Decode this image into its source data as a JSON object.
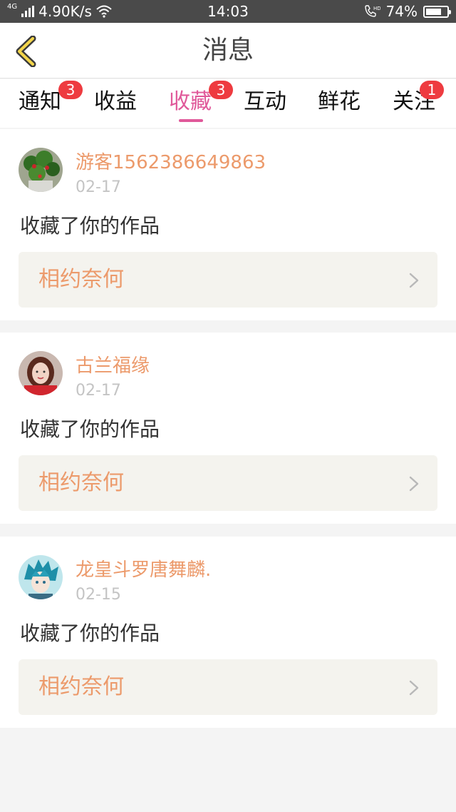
{
  "status_bar": {
    "network_type": "4G",
    "speed": "4.90K/s",
    "time": "14:03",
    "call_label": "HD",
    "battery_text": "74%",
    "battery_level": 0.74
  },
  "header": {
    "title": "消息"
  },
  "tabs": [
    {
      "label": "通知",
      "badge": "3",
      "active": false
    },
    {
      "label": "收益",
      "badge": "",
      "active": false
    },
    {
      "label": "收藏",
      "badge": "3",
      "active": true
    },
    {
      "label": "互动",
      "badge": "",
      "active": false
    },
    {
      "label": "鲜花",
      "badge": "",
      "active": false
    },
    {
      "label": "关注",
      "badge": "1",
      "active": false
    }
  ],
  "colors": {
    "accent": "#e0599a",
    "username": "#ec9a6b",
    "badge": "#ee3b40"
  },
  "messages": [
    {
      "username": "游客1562386649863",
      "date": "02-17",
      "action": "收藏了你的作品",
      "work_title": "相约奈何"
    },
    {
      "username": "古兰福缘",
      "date": "02-17",
      "action": "收藏了你的作品",
      "work_title": "相约奈何"
    },
    {
      "username": "龙皇斗罗唐舞麟.",
      "date": "02-15",
      "action": "收藏了你的作品",
      "work_title": "相约奈何"
    }
  ]
}
